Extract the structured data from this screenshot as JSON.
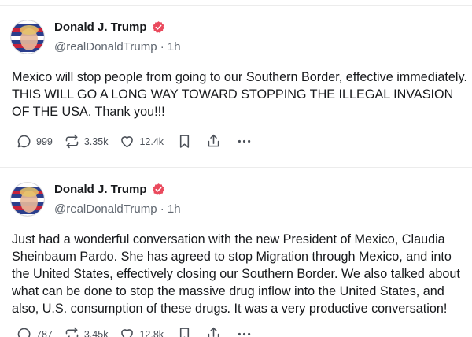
{
  "posts": [
    {
      "author": {
        "name": "Donald J. Trump",
        "handle": "@realDonaldTrump",
        "separator": "·",
        "time": "1h",
        "verified_color": "#ea4a5d"
      },
      "text": "Mexico will stop people from going to our Southern Border, effective immediately. THIS WILL GO A LONG WAY TOWARD STOPPING THE ILLEGAL INVASION OF THE USA. Thank you!!!",
      "stats": {
        "replies": "999",
        "reposts": "3.35k",
        "likes": "12.4k"
      }
    },
    {
      "author": {
        "name": "Donald J. Trump",
        "handle": "@realDonaldTrump",
        "separator": "·",
        "time": "1h",
        "verified_color": "#ea4a5d"
      },
      "text": "Just had a wonderful conversation with the new President of Mexico, Claudia Sheinbaum Pardo. She has agreed to stop Migration through Mexico, and into the United States, effectively closing our Southern Border. We also talked about what can be done to stop the massive drug inflow into the United States, and also, U.S. consumption of these drugs. It was a very productive conversation!",
      "stats": {
        "replies": "787",
        "reposts": "3.45k",
        "likes": "12.8k"
      }
    }
  ],
  "icons": {
    "reply": "reply-icon",
    "repost": "repost-icon",
    "like": "heart-icon",
    "bookmark": "bookmark-icon",
    "share": "share-icon",
    "more": "more-icon",
    "verified": "verified-badge-icon"
  }
}
